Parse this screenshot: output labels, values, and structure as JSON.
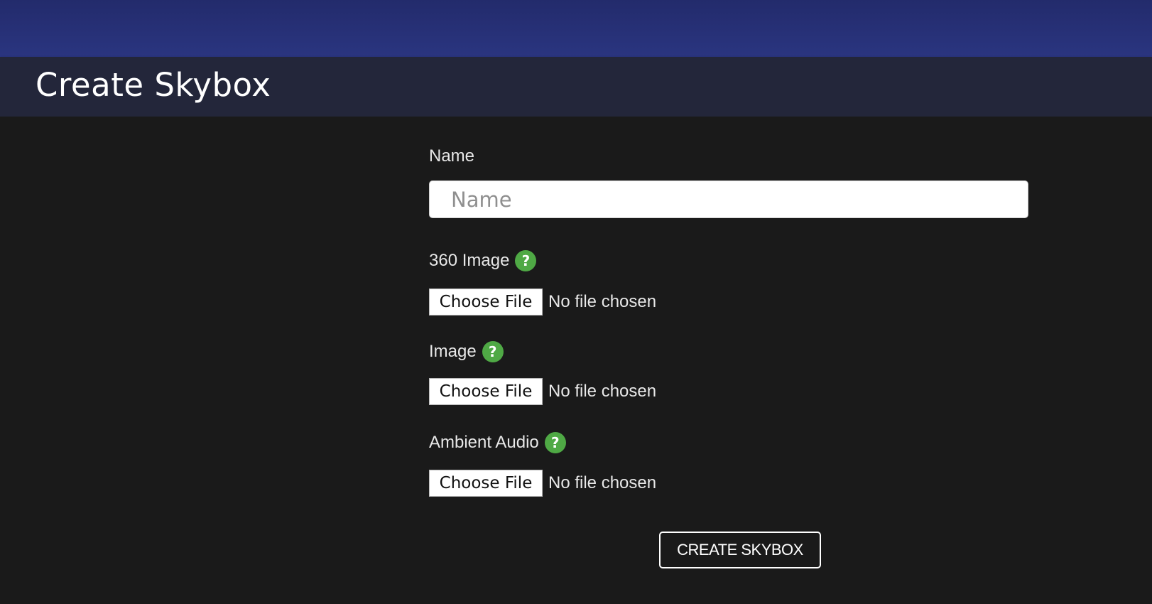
{
  "header": {
    "title": "Create Skybox"
  },
  "form": {
    "name": {
      "label": "Name",
      "placeholder": "Name",
      "value": ""
    },
    "image360": {
      "label": "360 Image",
      "help_icon": "question-mark-icon",
      "button_label": "Choose File",
      "status": "No file chosen"
    },
    "image": {
      "label": "Image",
      "help_icon": "question-mark-icon",
      "button_label": "Choose File",
      "status": "No file chosen"
    },
    "ambient_audio": {
      "label": "Ambient Audio",
      "help_icon": "question-mark-icon",
      "button_label": "Choose File",
      "status": "No file chosen"
    },
    "submit_label": "CREATE SKYBOX"
  },
  "colors": {
    "top_bar": "#2a3580",
    "title_bar": "#23263a",
    "background": "#1a1a1a",
    "help_icon": "#4fa945"
  }
}
